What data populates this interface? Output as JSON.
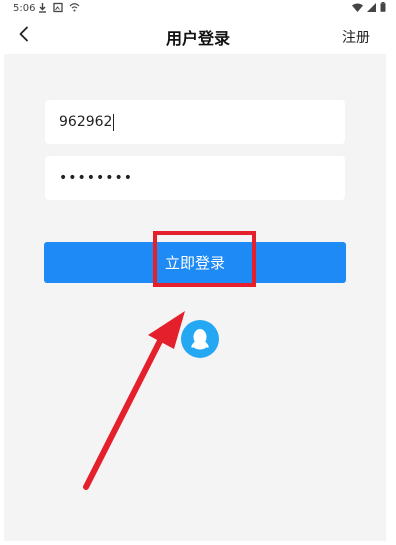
{
  "status_bar": {
    "time": "5:06",
    "left_icons": [
      "download-icon",
      "photo-icon",
      "cast-icon"
    ],
    "right_icons": [
      "wifi-icon",
      "signal-icon",
      "battery-icon"
    ]
  },
  "nav": {
    "title": "用户登录",
    "register_label": "注册",
    "back_icon": "chevron-left-icon"
  },
  "form": {
    "username_value": "962962",
    "password_masked": "••••••••"
  },
  "login_button_label": "立即登录",
  "qq_login_icon": "qq-penguin-icon",
  "colors": {
    "primary": "#1e8af5",
    "qq_blue": "#24a8f3",
    "annotation_red": "#e3202b",
    "content_background": "#f4f4f5"
  }
}
